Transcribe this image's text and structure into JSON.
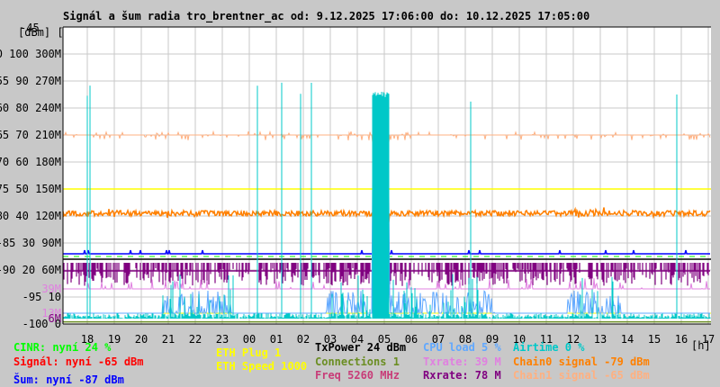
{
  "chart_data": {
    "type": "line",
    "title": "Signál a šum radia tro_brentner_ac od: 9.12.2025 17:06:00 do: 10.12.2025 17:05:00",
    "y_axis_header": "[dBm] [%]",
    "y_top_label": "-45",
    "x_unit_label": "[h]",
    "x_ticks": [
      "18",
      "19",
      "20",
      "21",
      "22",
      "23",
      "00",
      "01",
      "02",
      "03",
      "04",
      "05",
      "06",
      "07",
      "08",
      "09",
      "10",
      "11",
      "12",
      "13",
      "14",
      "15",
      "16",
      "17"
    ],
    "y_ticks_dbm": [
      "-50",
      "-55",
      "-60",
      "-65",
      "-70",
      "-75",
      "-80",
      "-85",
      "-90",
      "-95",
      "-100"
    ],
    "y_ticks_pct": [
      "100",
      "90",
      "80",
      "70",
      "60",
      "50",
      "40",
      "30",
      "20",
      "10",
      "0"
    ],
    "y_ticks_rate": [
      "300M",
      "270M",
      "240M",
      "210M",
      "180M",
      "150M",
      "120M",
      "90M",
      "60M"
    ],
    "rate_markers": [
      {
        "label": "39M",
        "color": "#e080e0",
        "value_dbm": -93.5
      },
      {
        "label": "13M",
        "color": "#e080e0",
        "value_dbm": -98
      },
      {
        "label": "6M",
        "color": "#800080",
        "value_dbm": -99
      }
    ],
    "ylim_dbm": [
      -100,
      -45
    ],
    "grid": true,
    "series": [
      {
        "name": "Chain1 signal",
        "color": "#ffb080",
        "level_dbm": -65
      },
      {
        "name": "ETH Speed",
        "color": "#ffff00",
        "level_dbm": -75
      },
      {
        "name": "Chain0 signal",
        "color": "#ff8000",
        "level_dbm": -79.5
      },
      {
        "name": "Šum",
        "color": "#0000ff",
        "level_dbm": -87
      },
      {
        "name": "CINR",
        "color": "#00ff00",
        "level_dbm": -87.5
      },
      {
        "name": "TxPower",
        "color": "#000000",
        "level_dbm": -88
      },
      {
        "name": "Rxrate",
        "color": "#800080",
        "level_dbm": -90
      },
      {
        "name": "Txrate",
        "color": "#e080e0",
        "level_dbm": -93.5
      },
      {
        "name": "CPU load",
        "color": "#60a8ff",
        "level_dbm": -98
      },
      {
        "name": "Airtime",
        "color": "#00c8c8",
        "level_dbm": -99
      },
      {
        "name": "ETH Plug",
        "color": "#ffff00",
        "level_dbm": -98
      },
      {
        "name": "Connections",
        "color": "#6b8e23",
        "level_dbm": -99.6
      }
    ]
  },
  "legend": {
    "cinr": {
      "text": "CINR: nyní 24 %",
      "color": "#00ff00"
    },
    "signal": {
      "text": "Signál: nyní -65 dBm",
      "color": "#ff0000"
    },
    "noise": {
      "text": "Šum: nyní -87 dBm",
      "color": "#0000ff"
    },
    "eth_plug": {
      "text": "ETH Plug 1",
      "color": "#ffff00"
    },
    "eth_speed": {
      "text": "ETH Speed 1000",
      "color": "#ffff00"
    },
    "txpower": {
      "text": "TxPower 24 dBm",
      "color": "#000000"
    },
    "connections": {
      "text": "Connections 1",
      "color": "#6b8e23"
    },
    "freq": {
      "text": "Freq 5260 MHz",
      "color": "#c83c78"
    },
    "cpu": {
      "text": "CPU load 5 %",
      "color": "#60a8ff"
    },
    "txrate": {
      "text": "Txrate: 39 M",
      "color": "#e080e0"
    },
    "rxrate": {
      "text": "Rxrate: 78 M",
      "color": "#800080"
    },
    "airtime": {
      "text": "Airtime 0 %",
      "color": "#00c8c8"
    },
    "chain0": {
      "text": "Chain0 signal -79 dBm",
      "color": "#ff8000"
    },
    "chain1": {
      "text": "Chain1 signal -65 dBm",
      "color": "#ffb080"
    }
  }
}
